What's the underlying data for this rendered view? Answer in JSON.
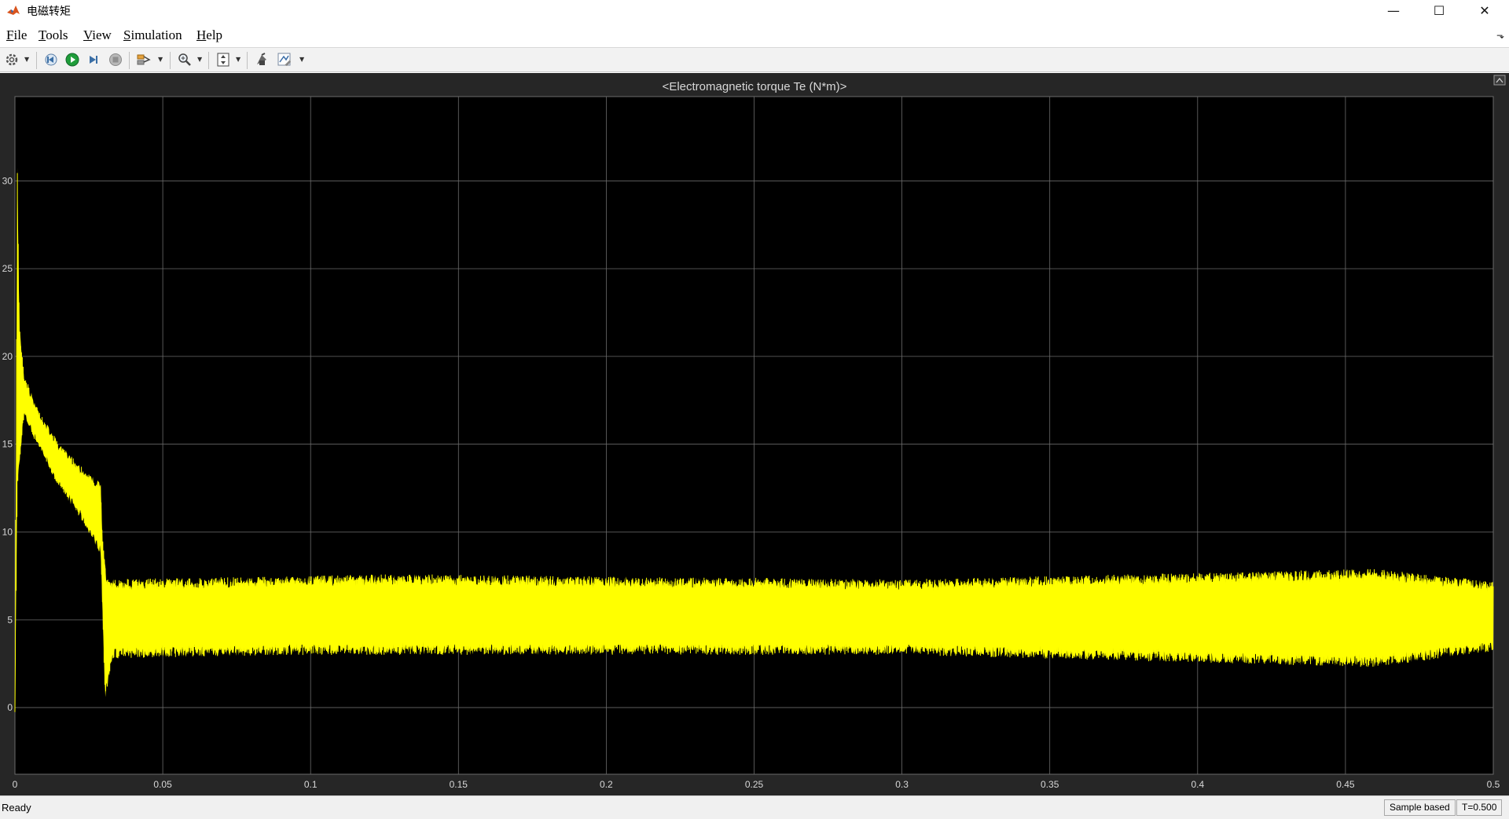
{
  "window": {
    "title": "电磁转矩",
    "minimize": "—",
    "maximize": "☐",
    "close": "✕"
  },
  "menu": [
    {
      "label": "File",
      "accel": "F",
      "rest": "ile"
    },
    {
      "label": "Tools",
      "accel": "T",
      "rest": "ools"
    },
    {
      "label": "View",
      "accel": "V",
      "rest": "iew"
    },
    {
      "label": "Simulation",
      "accel": "S",
      "rest": "imulation"
    },
    {
      "label": "Help",
      "accel": "H",
      "rest": "elp"
    }
  ],
  "toolbar": {
    "icons": [
      "gear-icon",
      "step-back-icon",
      "run-icon",
      "step-forward-icon",
      "stop-icon",
      "signal-select-icon",
      "zoom-icon",
      "fit-axes-icon",
      "highlight-block-icon",
      "triggers-icon"
    ]
  },
  "colors": {
    "scope_bg": "#262626",
    "plot_bg": "#000000",
    "grid": "#6b6b6b",
    "trace": "#ffff00",
    "axis_text": "#d8d8d8"
  },
  "status": {
    "ready": "Ready",
    "sample_mode": "Sample based",
    "time": "T=0.500"
  },
  "chart_data": {
    "type": "line",
    "title": "<Electromagnetic torque Te (N*m)>",
    "xlabel": "",
    "ylabel": "",
    "xlim": [
      0,
      0.5
    ],
    "ylim": [
      -3.8,
      34.8
    ],
    "x_ticks": [
      "0",
      "0.05",
      "0.1",
      "0.15",
      "0.2",
      "0.25",
      "0.3",
      "0.35",
      "0.4",
      "0.45",
      "0.5"
    ],
    "y_ticks": [
      "0",
      "5",
      "10",
      "15",
      "20",
      "25",
      "30"
    ],
    "grid": true,
    "series": [
      {
        "color": "#ffff00",
        "envelope_upper": [
          {
            "x": 0.0,
            "y": 0
          },
          {
            "x": 0.0008,
            "y": 31
          },
          {
            "x": 0.0015,
            "y": 22
          },
          {
            "x": 0.003,
            "y": 19
          },
          {
            "x": 0.008,
            "y": 17
          },
          {
            "x": 0.015,
            "y": 15
          },
          {
            "x": 0.022,
            "y": 13.8
          },
          {
            "x": 0.029,
            "y": 12.8
          },
          {
            "x": 0.0295,
            "y": 10
          },
          {
            "x": 0.031,
            "y": 7.3
          },
          {
            "x": 0.13,
            "y": 7.6
          },
          {
            "x": 0.3,
            "y": 7.3
          },
          {
            "x": 0.46,
            "y": 7.9
          },
          {
            "x": 0.5,
            "y": 7.2
          }
        ],
        "envelope_lower": [
          {
            "x": 0.0,
            "y": 0
          },
          {
            "x": 0.0008,
            "y": 12.5
          },
          {
            "x": 0.003,
            "y": 16.5
          },
          {
            "x": 0.008,
            "y": 14.8
          },
          {
            "x": 0.015,
            "y": 12.5
          },
          {
            "x": 0.022,
            "y": 10.8
          },
          {
            "x": 0.029,
            "y": 8.7
          },
          {
            "x": 0.0305,
            "y": 0.4
          },
          {
            "x": 0.033,
            "y": 2.8
          },
          {
            "x": 0.1,
            "y": 3.0
          },
          {
            "x": 0.3,
            "y": 3.0
          },
          {
            "x": 0.46,
            "y": 2.3
          },
          {
            "x": 0.5,
            "y": 3.2
          }
        ]
      }
    ]
  }
}
